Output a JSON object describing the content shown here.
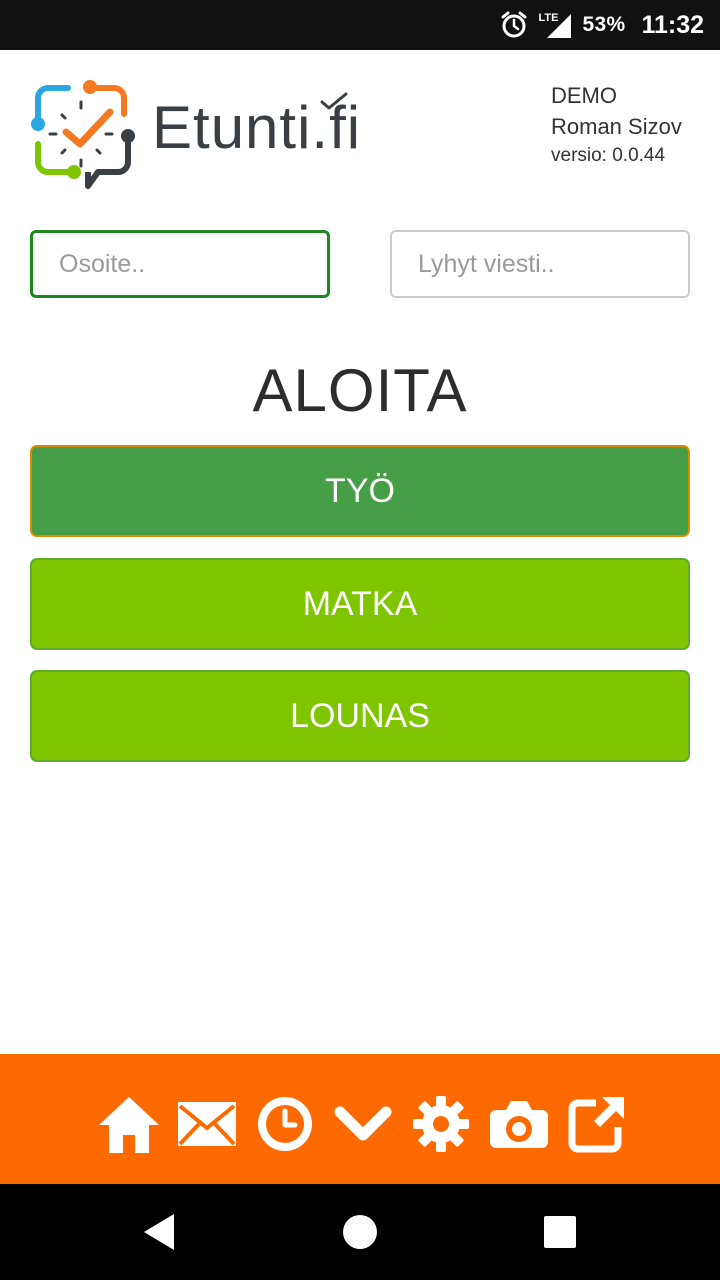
{
  "status_bar": {
    "network": "LTE",
    "battery": "53%",
    "time": "11:32",
    "icons": [
      "alarm-icon",
      "signal-icon"
    ]
  },
  "header": {
    "logo_text": "Etunti.fi",
    "company": "DEMO",
    "user_name": "Roman Sizov",
    "version": "versio: 0.0.44"
  },
  "inputs": {
    "address_placeholder": "Osoite..",
    "address_value": "",
    "message_placeholder": "Lyhyt viesti..",
    "message_value": ""
  },
  "section": {
    "title": "ALOITA",
    "buttons": [
      {
        "label": "TYÖ"
      },
      {
        "label": "MATKA"
      },
      {
        "label": "LOUNAS"
      }
    ]
  },
  "toolbar": {
    "icons": [
      "home-icon",
      "mail-icon",
      "clock-icon",
      "chevron-down-icon",
      "gear-icon",
      "camera-icon",
      "external-link-icon"
    ]
  },
  "colors": {
    "toolbar": "#ff6a00",
    "work_button": "#469f46",
    "action_button": "#7fc600",
    "focus_border": "#1e8a1e"
  }
}
